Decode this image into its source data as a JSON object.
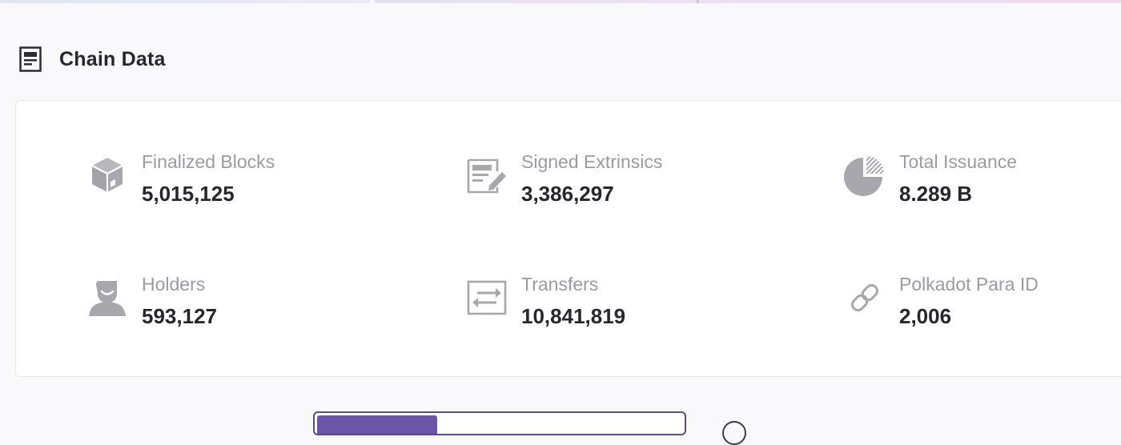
{
  "section": {
    "title": "Chain Data",
    "icon": "document-list-icon"
  },
  "stats": [
    {
      "label": "Finalized Blocks",
      "value": "5,015,125",
      "icon": "cube-icon"
    },
    {
      "label": "Signed Extrinsics",
      "value": "3,386,297",
      "icon": "signed-document-icon"
    },
    {
      "label": "Total Issuance",
      "value": "8.289 B",
      "icon": "pie-chart-icon"
    },
    {
      "label": "Holders",
      "value": "593,127",
      "icon": "user-icon"
    },
    {
      "label": "Transfers",
      "value": "10,841,819",
      "icon": "transfer-arrows-icon"
    },
    {
      "label": "Polkadot Para ID",
      "value": "2,006",
      "icon": "link-icon"
    }
  ],
  "colors": {
    "icon_gray": "#a7a7ad",
    "label_gray": "#9a9aa3",
    "value_dark": "#26262e",
    "accent_purple": "#6a55a8"
  }
}
